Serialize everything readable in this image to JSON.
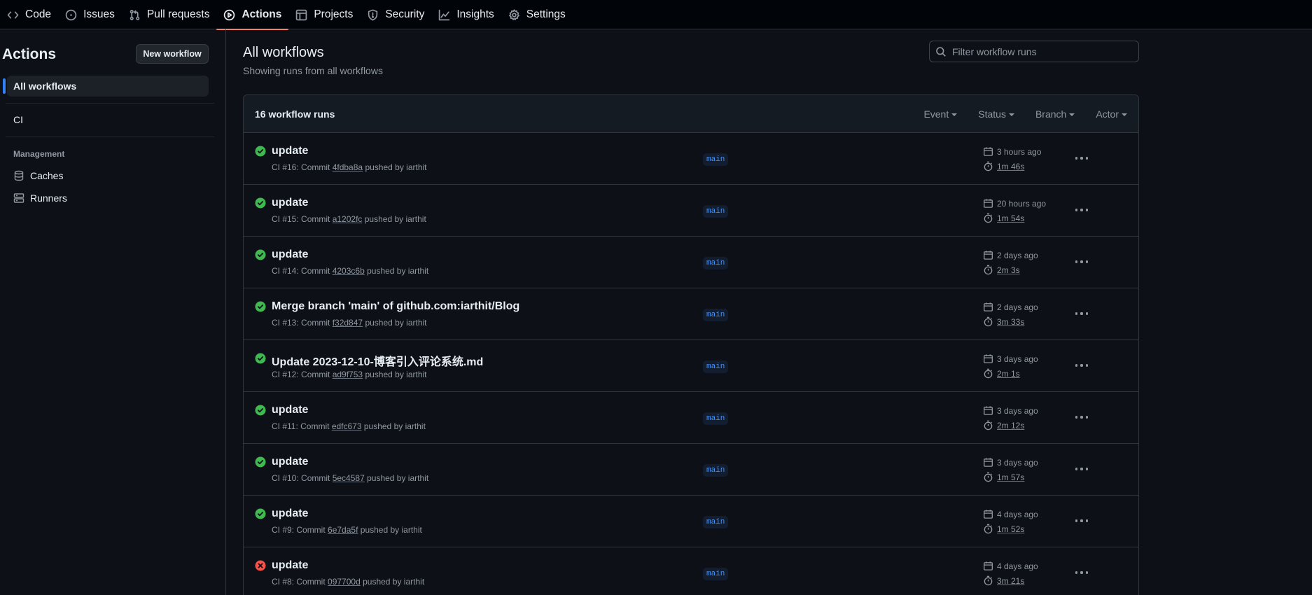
{
  "nav": {
    "tabs": [
      {
        "label": "Code",
        "icon": "code-icon"
      },
      {
        "label": "Issues",
        "icon": "issue-opened-icon"
      },
      {
        "label": "Pull requests",
        "icon": "git-pull-request-icon"
      },
      {
        "label": "Actions",
        "icon": "play-icon",
        "active": true
      },
      {
        "label": "Projects",
        "icon": "table-icon"
      },
      {
        "label": "Security",
        "icon": "shield-icon"
      },
      {
        "label": "Insights",
        "icon": "graph-icon"
      },
      {
        "label": "Settings",
        "icon": "gear-icon"
      }
    ],
    "active_color": "#f78166"
  },
  "sidebar": {
    "title": "Actions",
    "new_workflow_label": "New workflow",
    "all_workflows_label": "All workflows",
    "workflows": [
      "CI"
    ],
    "management_label": "Management",
    "management_items": [
      {
        "label": "Caches",
        "icon": "database-icon"
      },
      {
        "label": "Runners",
        "icon": "server-icon"
      }
    ]
  },
  "main": {
    "title": "All workflows",
    "subtitle": "Showing runs from all workflows",
    "filter_placeholder": "Filter workflow runs",
    "runs_count_label": "16 workflow runs",
    "filters": [
      "Event",
      "Status",
      "Branch",
      "Actor"
    ]
  },
  "runs": [
    {
      "status": "success",
      "title": "update",
      "ci": "CI #16: Commit",
      "sha": "4fdba8a",
      "by": "pushed by iarthit",
      "branch": "main",
      "when": "3 hours ago",
      "duration": "1m 46s"
    },
    {
      "status": "success",
      "title": "update",
      "ci": "CI #15: Commit",
      "sha": "a1202fc",
      "by": "pushed by iarthit",
      "branch": "main",
      "when": "20 hours ago",
      "duration": "1m 54s"
    },
    {
      "status": "success",
      "title": "update",
      "ci": "CI #14: Commit",
      "sha": "4203c6b",
      "by": "pushed by iarthit",
      "branch": "main",
      "when": "2 days ago",
      "duration": "2m 3s"
    },
    {
      "status": "success",
      "title": "Merge branch 'main' of github.com:iarthit/Blog",
      "ci": "CI #13: Commit",
      "sha": "f32d847",
      "by": "pushed by iarthit",
      "branch": "main",
      "when": "2 days ago",
      "duration": "3m 33s"
    },
    {
      "status": "success",
      "title": "Update 2023-12-10-博客引入评论系统.md",
      "ci": "CI #12: Commit",
      "sha": "ad9f753",
      "by": "pushed by iarthit",
      "branch": "main",
      "when": "3 days ago",
      "duration": "2m 1s"
    },
    {
      "status": "success",
      "title": "update",
      "ci": "CI #11: Commit",
      "sha": "edfc673",
      "by": "pushed by iarthit",
      "branch": "main",
      "when": "3 days ago",
      "duration": "2m 12s"
    },
    {
      "status": "success",
      "title": "update",
      "ci": "CI #10: Commit",
      "sha": "5ec4587",
      "by": "pushed by iarthit",
      "branch": "main",
      "when": "3 days ago",
      "duration": "1m 57s"
    },
    {
      "status": "success",
      "title": "update",
      "ci": "CI #9: Commit",
      "sha": "6e7da5f",
      "by": "pushed by iarthit",
      "branch": "main",
      "when": "4 days ago",
      "duration": "1m 52s"
    },
    {
      "status": "failure",
      "title": "update",
      "ci": "CI #8: Commit",
      "sha": "097700d",
      "by": "pushed by iarthit",
      "branch": "main",
      "when": "4 days ago",
      "duration": "3m 21s"
    }
  ],
  "colors": {
    "success": "#3fb950",
    "failure": "#f85149",
    "branch_text": "#4493f8",
    "accent": "#2f81f7"
  }
}
